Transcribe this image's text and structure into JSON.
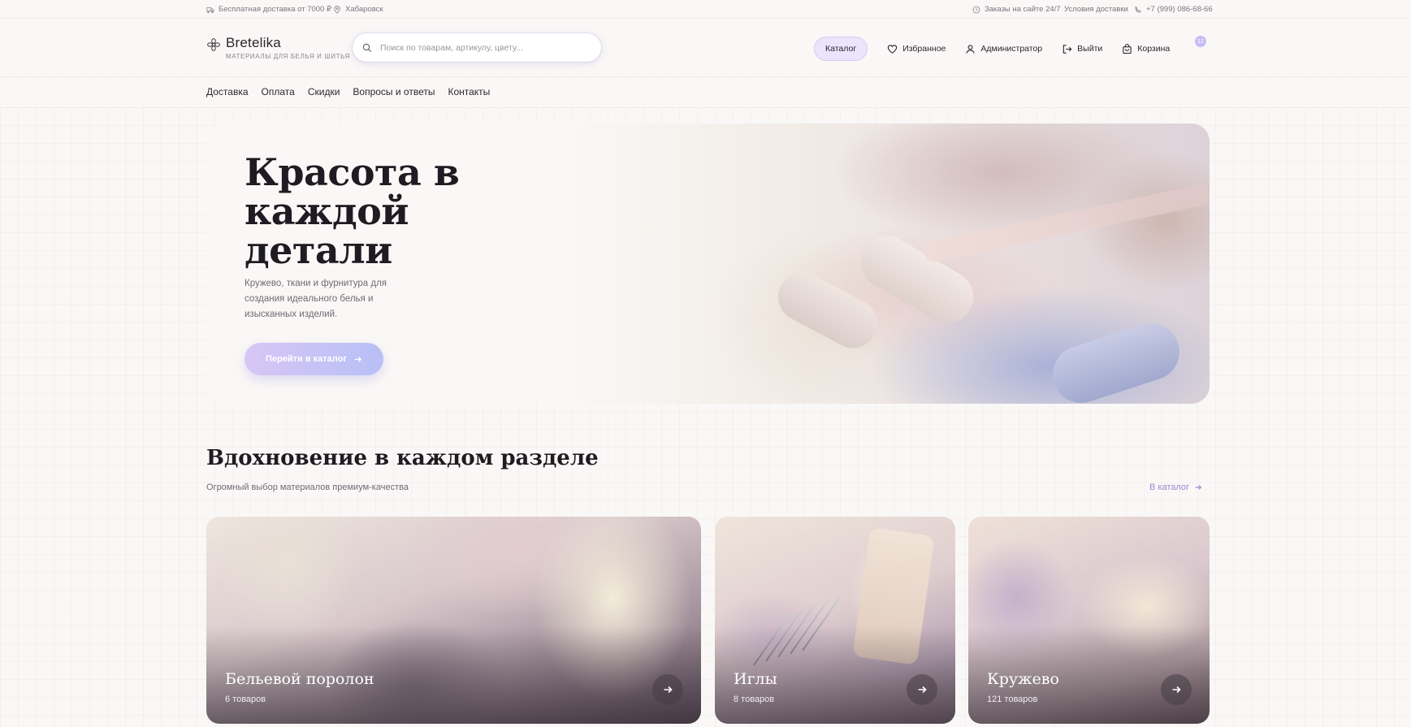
{
  "topbar": {
    "free_delivery": "Бесплатная доставка от 7000 ₽",
    "city": "Хабаровск",
    "orders_247": "Заказы на сайте 24/7",
    "delivery_terms": "Условия доставки",
    "phone": "+7 (999) 086-68-66"
  },
  "header": {
    "logo_name": "Bretelika",
    "logo_tagline": "МАТЕРИАЛЫ ДЛЯ БЕЛЬЯ И ШИТЬЯ",
    "search_placeholder": "Поиск по товарам, артикулу, цвету...",
    "catalog_label": "Каталог",
    "favorites_label": "Избранное",
    "admin_label": "Администратор",
    "logout_label": "Выйти",
    "cart_label": "Корзина",
    "cart_count": "12"
  },
  "subnav": {
    "items": [
      "Доставка",
      "Оплата",
      "Скидки",
      "Вопросы и ответы",
      "Контакты"
    ]
  },
  "hero": {
    "title": "Красота в каждой детали",
    "subtitle": "Кружево, ткани и фурнитура для создания идеального белья и изысканных изделий.",
    "cta_label": "Перейти в каталог"
  },
  "section": {
    "title": "Вдохновение в каждом разделе",
    "subtitle": "Огромный выбор материалов премиум-качества",
    "link_label": "В каталог"
  },
  "categories": [
    {
      "title": "Бельевой поролон",
      "count": "6 товаров"
    },
    {
      "title": "Иглы",
      "count": "8 товаров"
    },
    {
      "title": "Кружево",
      "count": "121 товаров"
    }
  ],
  "colors": {
    "accent": "#9a86d6",
    "catalog_pill": "#ebe4fb",
    "background": "#faf8f6"
  }
}
